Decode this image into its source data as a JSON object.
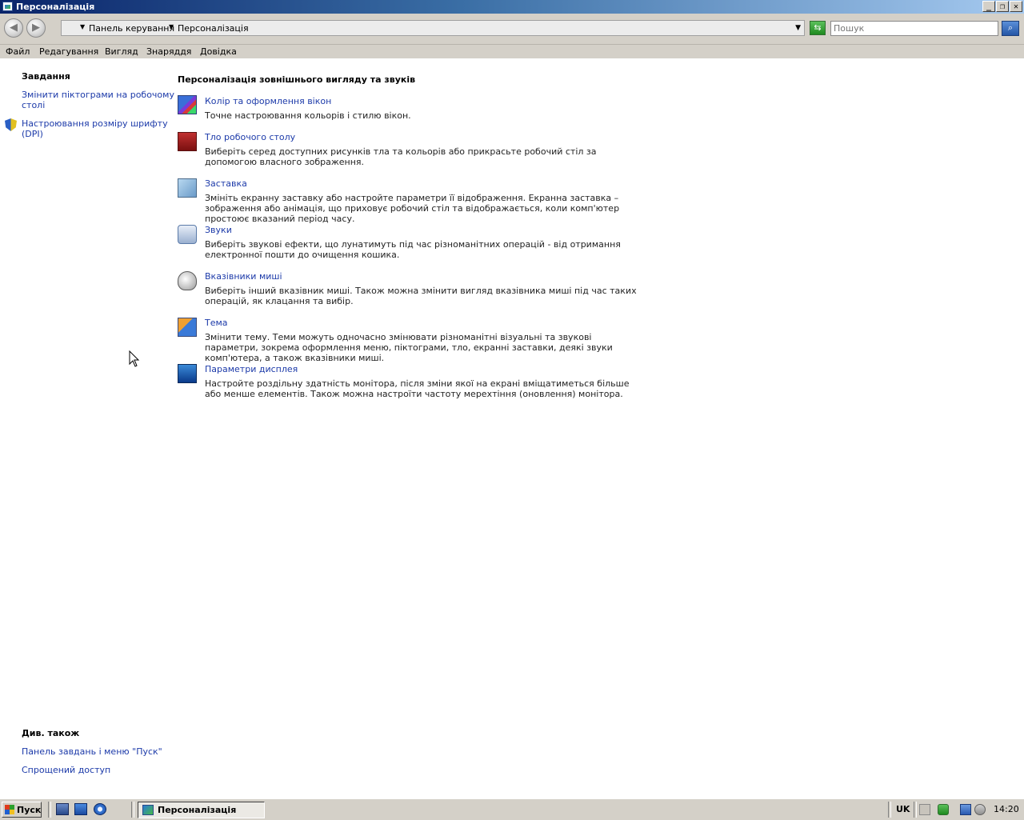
{
  "window": {
    "title": "Персоналізація"
  },
  "addressbar": {
    "crumbs": [
      "Панель керування",
      "Персоналізація"
    ],
    "search_placeholder": "Пошук"
  },
  "menu": [
    "Файл",
    "Редагування",
    "Вигляд",
    "Знаряддя",
    "Довідка"
  ],
  "sidebar": {
    "tasks_heading": "Завдання",
    "tasks": [
      {
        "label_line1": "Змінити піктограми на робочому",
        "label_line2": "столі"
      },
      {
        "label_line1": "Настроювання розміру шрифту",
        "label_line2": "(DPI)"
      }
    ],
    "see_also_heading": "Див. також",
    "see_also": [
      "Панель завдань і меню \"Пуск\"",
      "Спрощений доступ"
    ]
  },
  "main": {
    "title": "Персоналізація зовнішнього вигляду та звуків",
    "items": [
      {
        "icon": "window-color-icon",
        "title": "Колір та оформлення вікон",
        "desc": "Точне настроювання кольорів і стилю вікон."
      },
      {
        "icon": "desktop-background-icon",
        "title": "Тло робочого столу",
        "desc": "Виберіть серед доступних рисунків тла та кольорів або прикрасьте робочий стіл за допомогою власного зображення."
      },
      {
        "icon": "screensaver-icon",
        "title": "Заставка",
        "desc": "Змініть екранну заставку або настройте параметри її відображення. Екранна заставка – зображення або анімація, що приховує робочий стіл та відображається, коли комп'ютер простоює вказаний період часу."
      },
      {
        "icon": "sounds-icon",
        "title": "Звуки",
        "desc": "Виберіть звукові ефекти, що лунатимуть під час різноманітних операцій - від отримання електронної пошти до очищення кошика."
      },
      {
        "icon": "mouse-pointer-icon",
        "title": "Вказівники миші",
        "desc": "Виберіть інший вказівник миші. Також можна змінити вигляд вказівника миші під час таких операцій, як клацання та вибір."
      },
      {
        "icon": "theme-icon",
        "title": "Тема",
        "desc": "Змінити тему. Теми можуть одночасно змінювати різноманітні візуальні та звукові параметри, зокрема оформлення меню, піктограми, тло, екранні заставки, деякі звуки комп'ютера, а також вказівники миші."
      },
      {
        "icon": "display-settings-icon",
        "title": "Параметри дисплея",
        "desc": "Настройте роздільну здатність монітора, після зміни якої на екрані вміщатиметься більше або менше елементів. Також можна настроїти частоту мерехтіння (оновлення) монітора."
      }
    ]
  },
  "taskbar": {
    "start_label": "Пуск",
    "window_button": "Персоналізація",
    "language": "UK",
    "clock": "14:20"
  }
}
